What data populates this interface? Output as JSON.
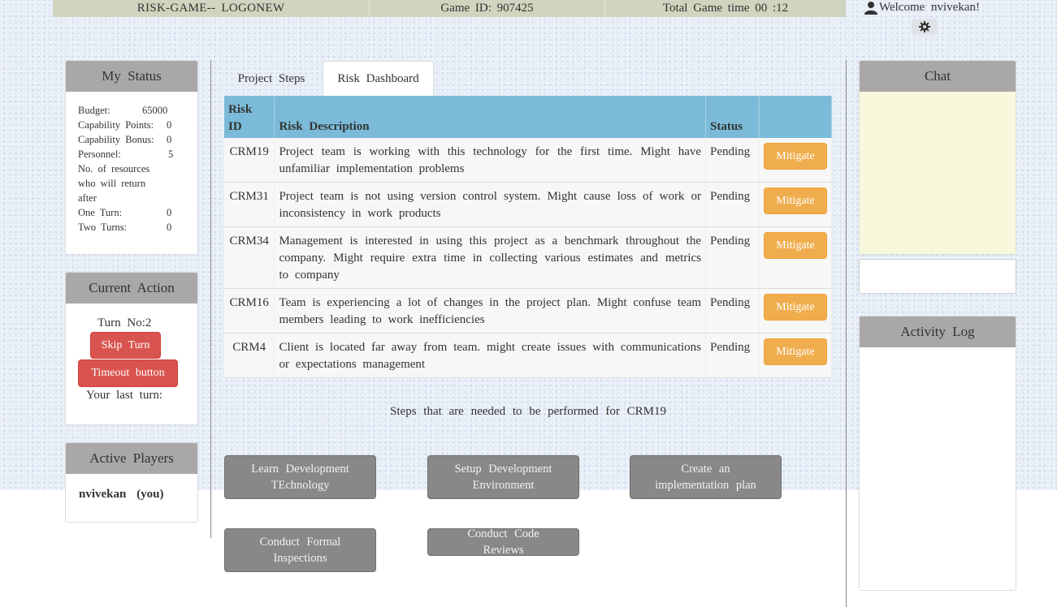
{
  "header": {
    "logo": "RISK-GAME-- LOGONEW",
    "game_id": "Game ID: 907425",
    "total_time": "Total Game time 00 :12",
    "welcome": "Welcome nvivekan!"
  },
  "my_status": {
    "title": "My Status",
    "budget_label": "Budget:",
    "budget_value": "65000",
    "capability_points_label": "Capability Points:",
    "capability_points_value": "0",
    "capability_bonus_label": "Capability Bonus:",
    "capability_bonus_value": "0",
    "personnel_label": "Personnel:",
    "personnel_value": "5",
    "resources_label": "No. of resources who will return after",
    "one_turn_label": "One Turn:",
    "one_turn_value": "0",
    "two_turns_label": "Two Turns:",
    "two_turns_value": "0"
  },
  "current_action": {
    "title": "Current Action",
    "turn_no": "Turn No:2",
    "skip_turn": "Skip Turn",
    "timeout_button": "Timeout button",
    "last_turn": "Your last turn:"
  },
  "active_players": {
    "title": "Active Players",
    "players": [
      {
        "name": "nvivekan (you)"
      }
    ]
  },
  "tabs": [
    {
      "label": "Project Steps",
      "active": false
    },
    {
      "label": "Risk Dashboard",
      "active": true
    }
  ],
  "risk_table": {
    "headers": {
      "id": "Risk ID",
      "description": "Risk Description",
      "status": "Status"
    },
    "rows": [
      {
        "id": "CRM19",
        "description": "Project team is working with this technology for the first time. Might have unfamiliar implementation problems",
        "status": "Pending",
        "action": "Mitigate"
      },
      {
        "id": "CRM31",
        "description": "Project team is not using version control system. Might cause loss of work or inconsistency in work products",
        "status": "Pending",
        "action": "Mitigate"
      },
      {
        "id": "CRM34",
        "description": "Management is interested in using this project as a benchmark throughout the company. Might require extra time in collecting various estimates and metrics to company",
        "status": "Pending",
        "action": "Mitigate"
      },
      {
        "id": "CRM16",
        "description": "Team is experiencing a lot of changes in the project plan. Might confuse team members leading to work inefficiencies",
        "status": "Pending",
        "action": "Mitigate"
      },
      {
        "id": "CRM4",
        "description": "Client is located far away from team. might create issues with communications or expectations management",
        "status": "Pending",
        "action": "Mitigate"
      }
    ]
  },
  "steps": {
    "title": "Steps that are needed to be performed for CRM19",
    "buttons": [
      "Learn Development TEchnology",
      "Setup Development Environment",
      "Create an implementation plan",
      "Conduct Formal Inspections",
      "Conduct Code Reviews"
    ]
  },
  "chat": {
    "title": "Chat",
    "input_value": ""
  },
  "activity_log": {
    "title": "Activity Log"
  },
  "colors": {
    "header_bar": "#cfd5be",
    "panel_header": "#a9a7a8",
    "table_header": "#7bbbd9",
    "mitigate": "#f0ad4e",
    "danger": "#d9534f",
    "step_button": "#888888",
    "chat_bg": "#f8f8dc"
  },
  "icons": [
    "user-icon",
    "gear-icon"
  ]
}
